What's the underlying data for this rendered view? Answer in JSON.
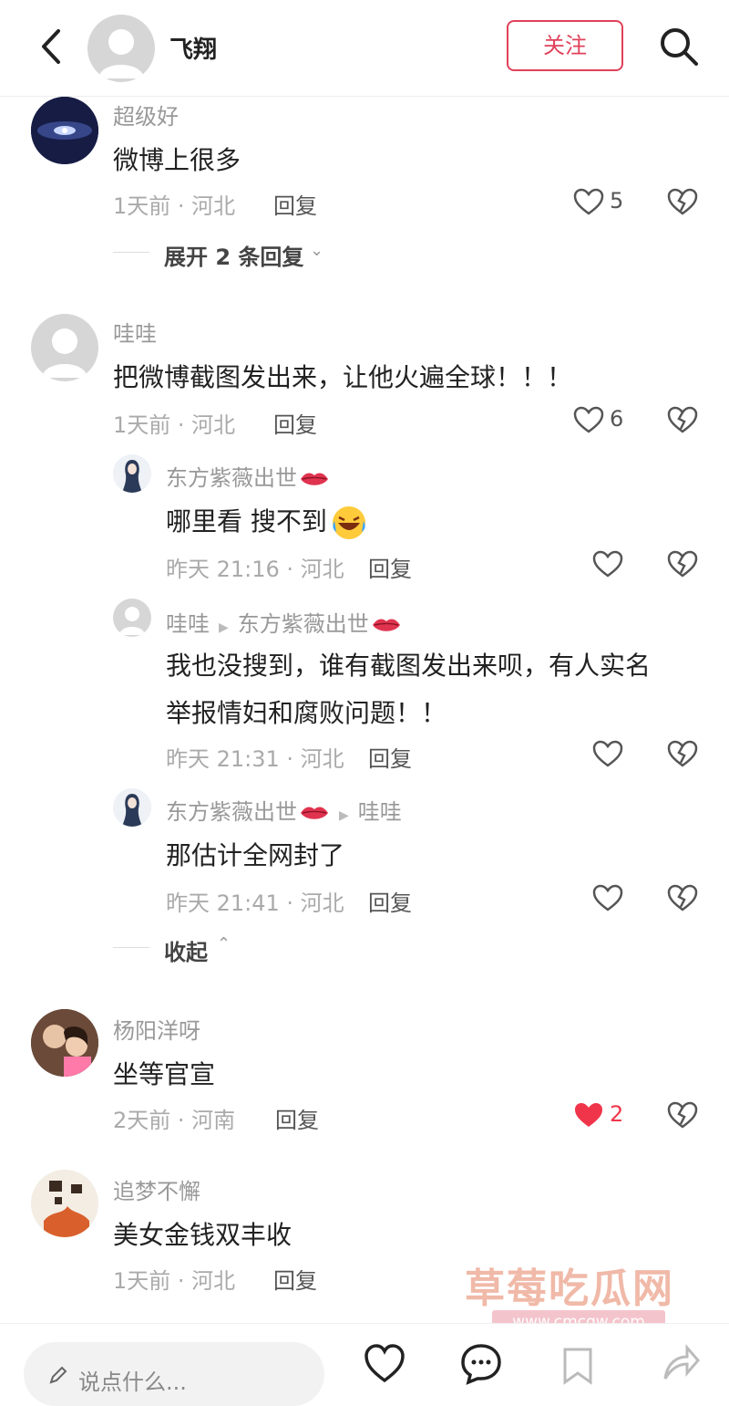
{
  "header": {
    "title": "飞翔",
    "follow_label": "关注"
  },
  "comments": [
    {
      "user": "超级好",
      "text": "微博上很多",
      "time": "1天前 · 河北",
      "reply": "回复",
      "likes": "5",
      "liked": false,
      "expand": "展开 2 条回复"
    },
    {
      "user": "哇哇",
      "text": "把微博截图发出来，让他火遍全球！！！",
      "time": "1天前 · 河北",
      "reply": "回复",
      "likes": "6",
      "liked": false,
      "replies": [
        {
          "user": "东方紫薇出世",
          "text": "哪里看 搜不到",
          "time": "昨天 21:16 · 河北",
          "reply": "回复"
        },
        {
          "user": "哇哇",
          "to": "东方紫薇出世",
          "text_line1": "我也没搜到，谁有截图发出来呗，有人实名",
          "text_line2": "举报情妇和腐败问题！！",
          "time": "昨天 21:31 · 河北",
          "reply": "回复"
        },
        {
          "user": "东方紫薇出世",
          "to": "哇哇",
          "text": "那估计全网封了",
          "time": "昨天 21:41 · 河北",
          "reply": "回复"
        }
      ],
      "collapse": "收起"
    },
    {
      "user": "杨阳洋呀",
      "text": "坐等官宣",
      "time": "2天前 · 河南",
      "reply": "回复",
      "likes": "2",
      "liked": true
    },
    {
      "user": "追梦不懈",
      "text": "美女金钱双丰收",
      "time": "1天前 · 河北",
      "reply": "回复"
    }
  ],
  "bottom": {
    "placeholder": "说点什么..."
  },
  "watermark": {
    "main": "草莓吃瓜网",
    "sub": "www.cmcgw.com"
  },
  "colors": {
    "accent": "#e0415a",
    "liked": "#f0354a"
  }
}
